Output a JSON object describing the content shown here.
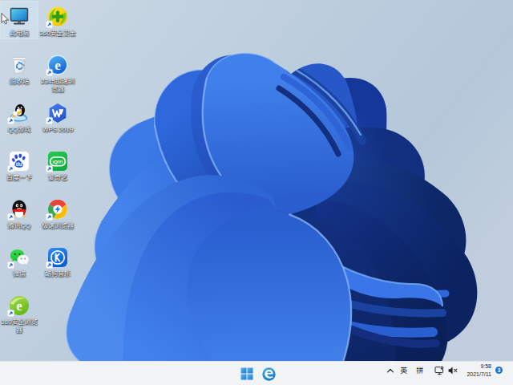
{
  "wallpaper": {
    "name": "windows-11-bloom",
    "background_top_left": "#cbd8e4",
    "background_right": "#b5c8da",
    "bloom_bright_blue": "#3a78e8",
    "bloom_dark_navy": "#0d2a6b"
  },
  "desktop": {
    "icons": [
      {
        "label": "此电脑",
        "name": "this-pc",
        "shortcut": false,
        "selected": true
      },
      {
        "label": "360安全卫士",
        "name": "360-safe-guard",
        "shortcut": true,
        "selected": false
      },
      {
        "label": "回收站",
        "name": "recycle-bin",
        "shortcut": false,
        "selected": false
      },
      {
        "label": "2345加速浏览器",
        "name": "2345-browser",
        "shortcut": true,
        "selected": false
      },
      {
        "label": "QQ游戏",
        "name": "qq-games",
        "shortcut": true,
        "selected": false
      },
      {
        "label": "WPS 2019",
        "name": "wps-2019",
        "shortcut": true,
        "selected": false
      },
      {
        "label": "百度一下",
        "name": "baidu-search",
        "shortcut": true,
        "selected": false
      },
      {
        "label": "爱奇艺",
        "name": "iqiyi",
        "shortcut": true,
        "selected": false
      },
      {
        "label": "腾讯QQ",
        "name": "tencent-qq",
        "shortcut": true,
        "selected": false
      },
      {
        "label": "极速浏览器",
        "name": "speed-browser",
        "shortcut": true,
        "selected": false
      },
      {
        "label": "微信",
        "name": "wechat",
        "shortcut": true,
        "selected": false
      },
      {
        "label": "酷狗音乐",
        "name": "kugou-music",
        "shortcut": true,
        "selected": false
      },
      {
        "label": "360安全浏览器",
        "name": "360-secure-browser",
        "shortcut": true,
        "selected": false
      }
    ]
  },
  "taskbar": {
    "background": "#f2f3f5",
    "center": {
      "start_icon": "windows-logo",
      "browser_icon": "edge-e-logo"
    },
    "tray": {
      "chevron_icon": "chevron-up",
      "ime_english": "英",
      "ime_pinyin": "拼",
      "hardware_icon": "monitor-pen",
      "volume_icon": "volume-muted",
      "clock": {
        "time": "9:58",
        "date": "2021/7/11"
      },
      "notification_badge": "3"
    }
  },
  "cursor": {
    "shape": "arrow"
  }
}
